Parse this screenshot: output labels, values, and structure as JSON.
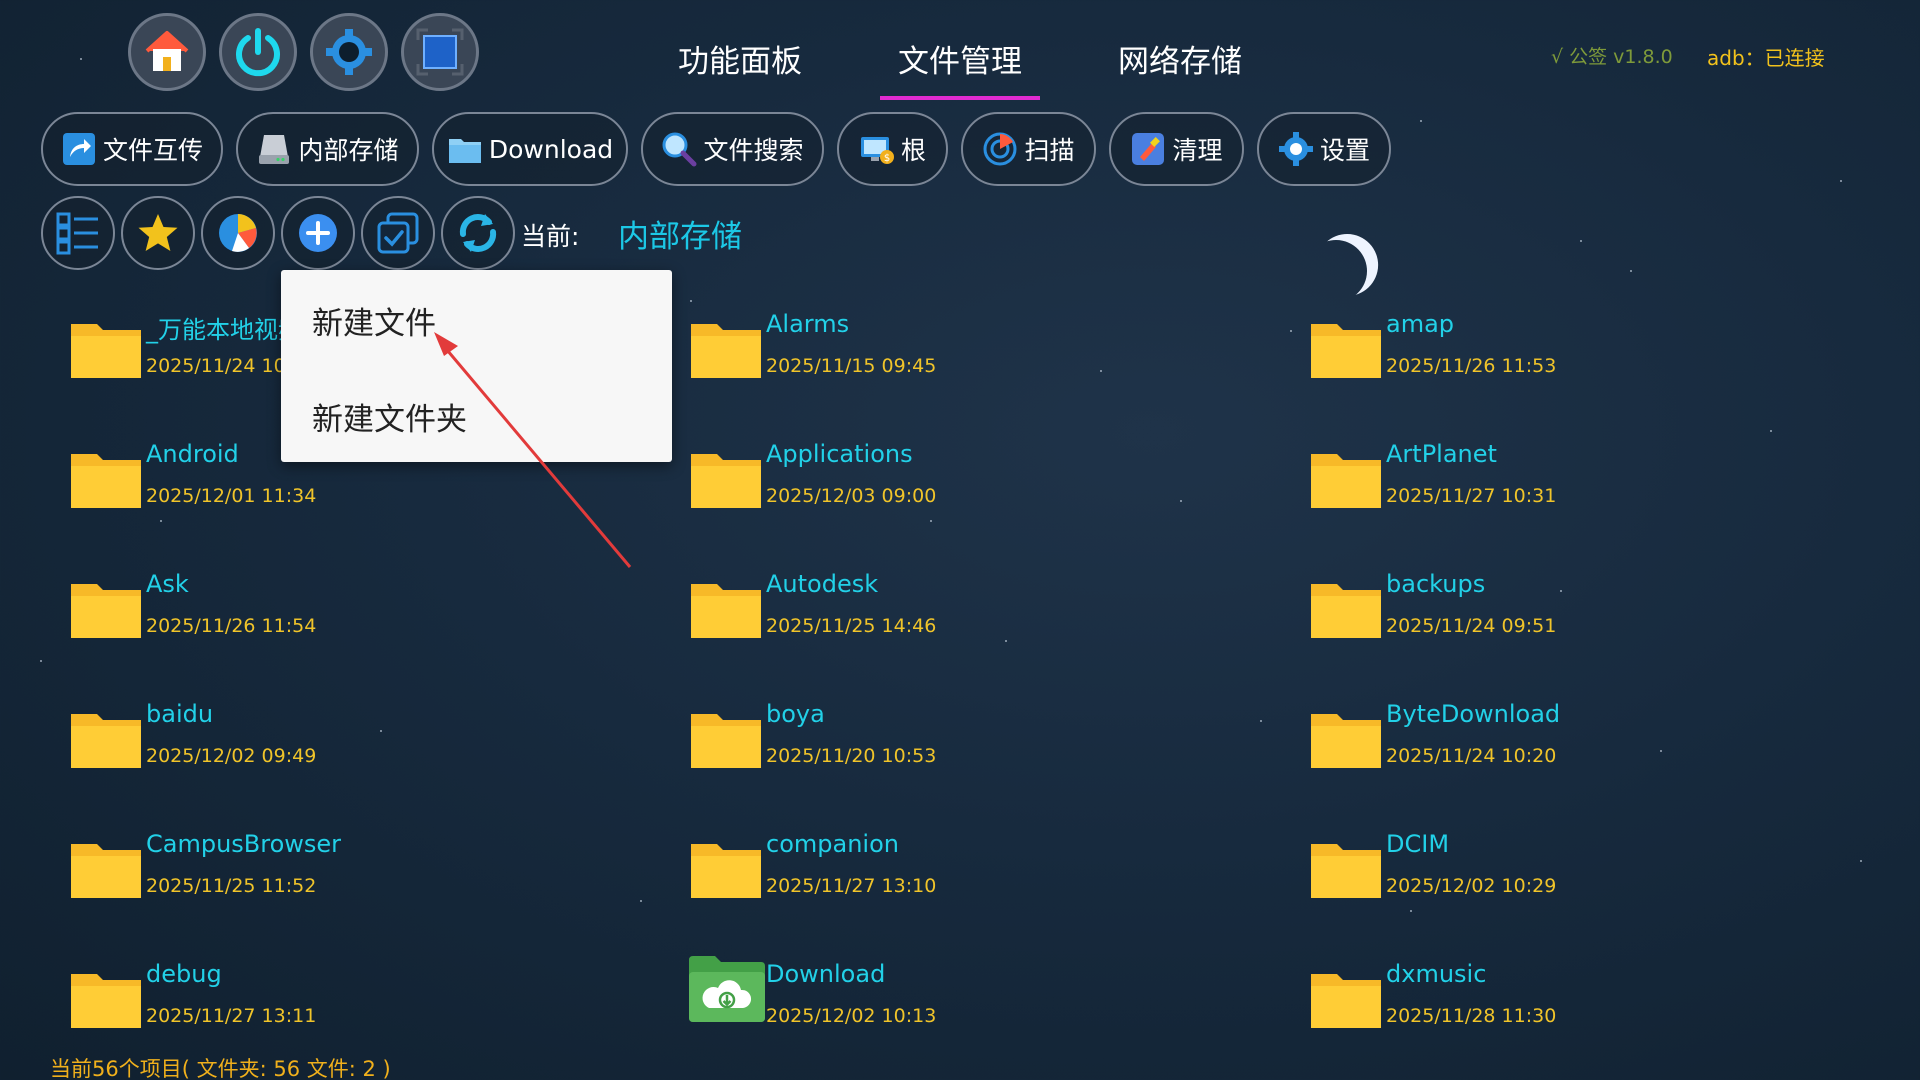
{
  "top_icons": [
    "home-icon",
    "power-icon",
    "gear-icon",
    "window-icon"
  ],
  "main_tabs": [
    "功能面板",
    "文件管理",
    "网络存储"
  ],
  "active_tab": "文件管理",
  "version": "√ 公签 v1.8.0",
  "adb_status": "adb：已连接",
  "toolbar": [
    {
      "label": "文件互传",
      "icon": "share-icon"
    },
    {
      "label": "内部存储",
      "icon": "drive-icon"
    },
    {
      "label": "Download",
      "icon": "folder-icon"
    },
    {
      "label": "文件搜索",
      "icon": "search-icon"
    },
    {
      "label": "根",
      "icon": "root-icon"
    },
    {
      "label": "扫描",
      "icon": "scan-icon"
    },
    {
      "label": "清理",
      "icon": "clean-icon"
    },
    {
      "label": "设置",
      "icon": "gear-icon"
    }
  ],
  "quick_icons": [
    "list-view-icon",
    "star-icon",
    "pie-chart-icon",
    "add-icon",
    "multi-select-icon",
    "refresh-icon"
  ],
  "current_label": "当前:",
  "current_path": "内部存储",
  "popup_menu": [
    "新建文件",
    "新建文件夹"
  ],
  "files": [
    {
      "name": "_万能本地视频",
      "date": "2025/11/24 10:50",
      "cloud": false
    },
    {
      "name": "Alarms",
      "date": "2025/11/15 09:45",
      "cloud": false
    },
    {
      "name": "amap",
      "date": "2025/11/26 11:53",
      "cloud": false
    },
    {
      "name": "Android",
      "date": "2025/12/01 11:34",
      "cloud": false
    },
    {
      "name": "Applications",
      "date": "2025/12/03 09:00",
      "cloud": false
    },
    {
      "name": "ArtPlanet",
      "date": "2025/11/27 10:31",
      "cloud": false
    },
    {
      "name": "Ask",
      "date": "2025/11/26 11:54",
      "cloud": false
    },
    {
      "name": "Autodesk",
      "date": "2025/11/25 14:46",
      "cloud": false
    },
    {
      "name": "backups",
      "date": "2025/11/24 09:51",
      "cloud": false
    },
    {
      "name": "baidu",
      "date": "2025/12/02 09:49",
      "cloud": false
    },
    {
      "name": "boya",
      "date": "2025/11/20 10:53",
      "cloud": false
    },
    {
      "name": "ByteDownload",
      "date": "2025/11/24 10:20",
      "cloud": false
    },
    {
      "name": "CampusBrowser",
      "date": "2025/11/25 11:52",
      "cloud": false
    },
    {
      "name": "companion",
      "date": "2025/11/27 13:10",
      "cloud": false
    },
    {
      "name": "DCIM",
      "date": "2025/12/02 10:29",
      "cloud": false
    },
    {
      "name": "debug",
      "date": "2025/11/27 13:11",
      "cloud": false
    },
    {
      "name": "Download",
      "date": "2025/12/02 10:13",
      "cloud": true
    },
    {
      "name": "dxmusic",
      "date": "2025/11/28 11:30",
      "cloud": false
    }
  ],
  "status_bar": "当前56个项目( 文件夹:  56   文件:  2 )",
  "colors": {
    "file_name": "#22d1e8",
    "file_date": "#f0c42a",
    "folder": "#ffcc33",
    "cloud_folder": "#4caf50",
    "tab_underline": "#e02bd0",
    "status": "#f0b01c"
  }
}
